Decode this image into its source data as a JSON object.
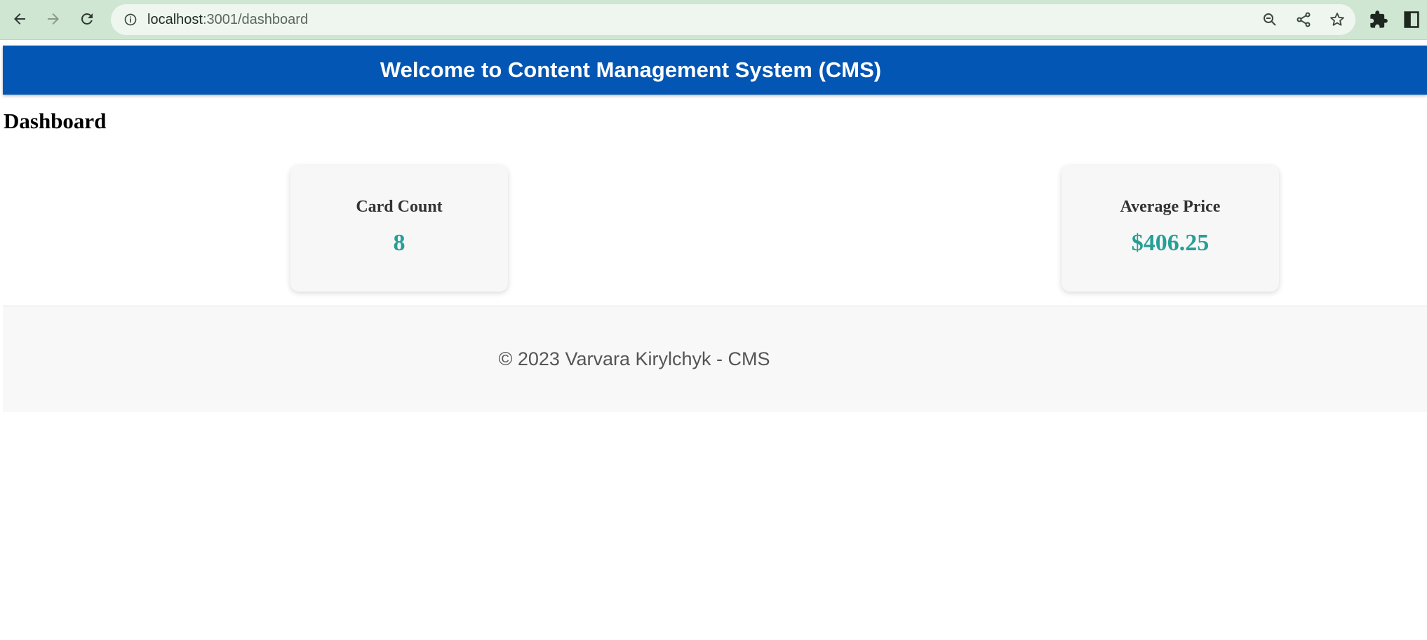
{
  "browser": {
    "url_host": "localhost",
    "url_path": ":3001/dashboard",
    "icons": {
      "back": "back-arrow-icon",
      "forward": "forward-arrow-icon",
      "reload": "reload-icon",
      "site_info": "info-icon",
      "zoom": "zoom-out-icon",
      "share": "share-icon",
      "bookmark": "star-icon",
      "extensions": "puzzle-icon",
      "window": "window-icon"
    }
  },
  "header": {
    "title": "Welcome to Content Management System (CMS)",
    "background": "#0356b3"
  },
  "main": {
    "page_title": "Dashboard",
    "stats": [
      {
        "label": "Card Count",
        "value": "8"
      },
      {
        "label": "Average Price",
        "value": "$406.25"
      }
    ],
    "accent_color": "#279f96"
  },
  "footer": {
    "text": "© 2023 Varvara Kirylchyk - CMS"
  }
}
